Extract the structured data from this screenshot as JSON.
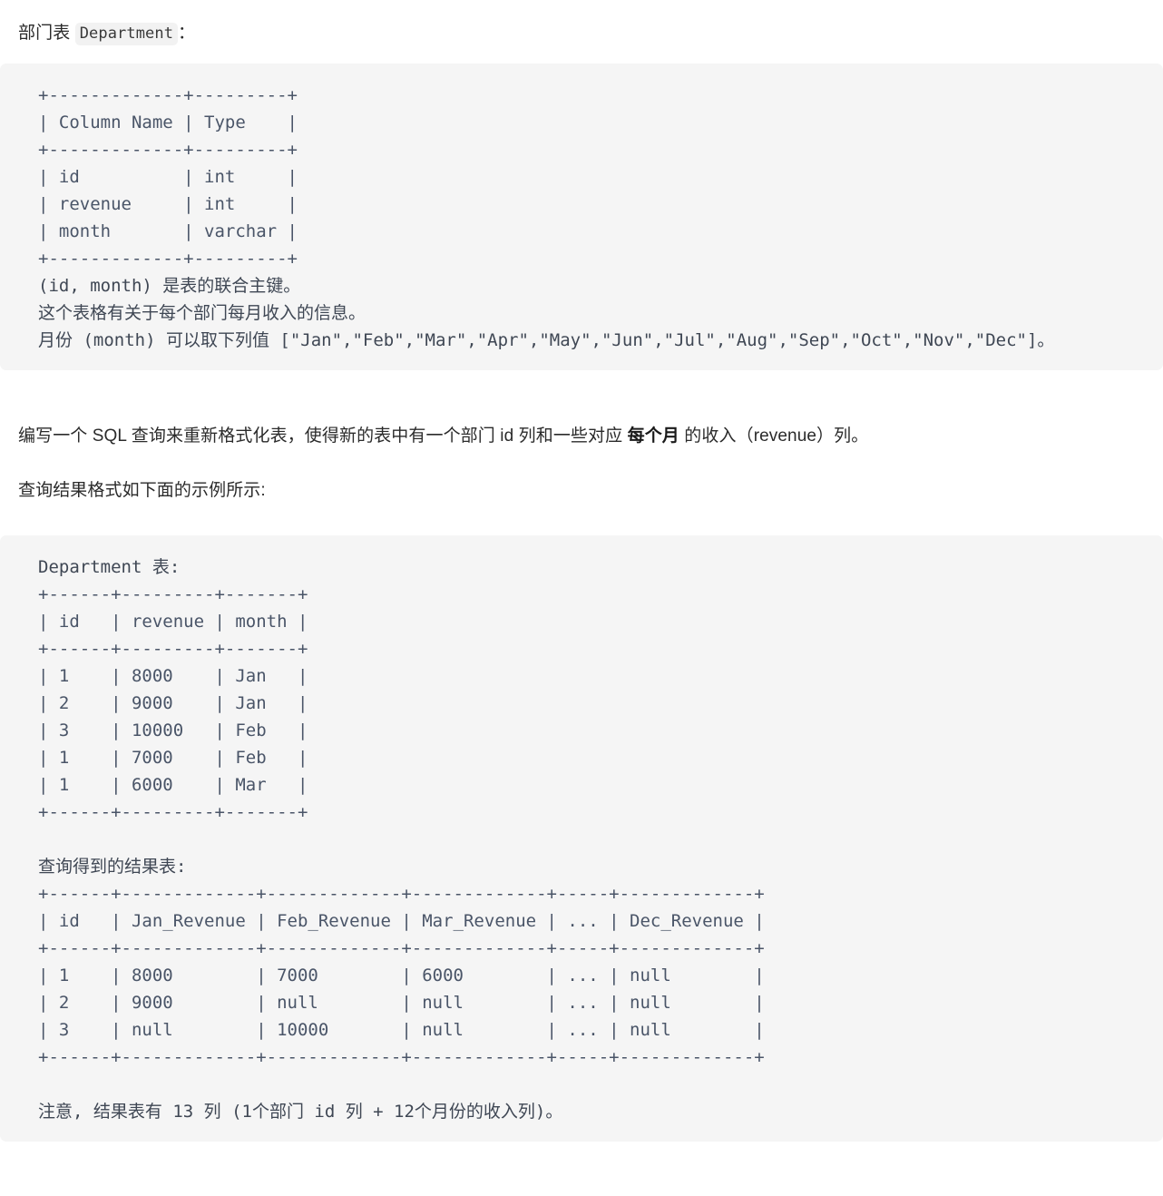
{
  "intro": {
    "prefix": "部门表 ",
    "code_chip": "Department",
    "suffix": "："
  },
  "schema_block": {
    "table_ascii": "+-------------+---------+\n| Column Name | Type    |\n+-------------+---------+\n| id          | int     |\n| revenue     | int     |\n| month       | varchar |\n+-------------+---------+",
    "note_primary_key": "(id, month) 是表的联合主键。",
    "note_description": "这个表格有关于每个部门每月收入的信息。",
    "note_months": "月份 (month) 可以取下列值 [\"Jan\",\"Feb\",\"Mar\",\"Apr\",\"May\",\"Jun\",\"Jul\",\"Aug\",\"Sep\",\"Oct\",\"Nov\",\"Dec\"]。"
  },
  "task": {
    "line1_part1": "编写一个 SQL 查询来重新格式化表，使得新的表中有一个部门 id 列和一些对应 ",
    "line1_bold": "每个月",
    "line1_part2": " 的收入（revenue）列。",
    "line2": "查询结果格式如下面的示例所示:"
  },
  "example_block": {
    "input_caption": "Department 表:",
    "input_ascii": "+------+---------+-------+\n| id   | revenue | month |\n+------+---------+-------+\n| 1    | 8000    | Jan   |\n| 2    | 9000    | Jan   |\n| 3    | 10000   | Feb   |\n| 1    | 7000    | Feb   |\n| 1    | 6000    | Mar   |\n+------+---------+-------+",
    "output_caption": "查询得到的结果表:",
    "output_ascii": "+------+-------------+-------------+-------------+-----+-------------+\n| id   | Jan_Revenue | Feb_Revenue | Mar_Revenue | ... | Dec_Revenue |\n+------+-------------+-------------+-------------+-----+-------------+\n| 1    | 8000        | 7000        | 6000        | ... | null        |\n| 2    | 9000        | null        | null        | ... | null        |\n| 3    | null        | 10000       | null        | ... | null        |\n+------+-------------+-------------+-------------+-----+-------------+",
    "footer_note": "注意, 结果表有 13 列 (1个部门 id 列 + 12个月份的收入列)。"
  },
  "table_data": {
    "schema": {
      "headers": [
        "Column Name",
        "Type"
      ],
      "rows": [
        [
          "id",
          "int"
        ],
        [
          "revenue",
          "int"
        ],
        [
          "month",
          "varchar"
        ]
      ]
    },
    "input_example": {
      "headers": [
        "id",
        "revenue",
        "month"
      ],
      "rows": [
        [
          "1",
          "8000",
          "Jan"
        ],
        [
          "2",
          "9000",
          "Jan"
        ],
        [
          "3",
          "10000",
          "Feb"
        ],
        [
          "1",
          "7000",
          "Feb"
        ],
        [
          "1",
          "6000",
          "Mar"
        ]
      ]
    },
    "output_example": {
      "headers": [
        "id",
        "Jan_Revenue",
        "Feb_Revenue",
        "Mar_Revenue",
        "...",
        "Dec_Revenue"
      ],
      "rows": [
        [
          "1",
          "8000",
          "7000",
          "6000",
          "...",
          "null"
        ],
        [
          "2",
          "9000",
          "null",
          "null",
          "...",
          "null"
        ],
        [
          "3",
          "null",
          "10000",
          "null",
          "...",
          "null"
        ]
      ]
    },
    "months": [
      "Jan",
      "Feb",
      "Mar",
      "Apr",
      "May",
      "Jun",
      "Jul",
      "Aug",
      "Sep",
      "Oct",
      "Nov",
      "Dec"
    ],
    "result_column_count": "13"
  }
}
